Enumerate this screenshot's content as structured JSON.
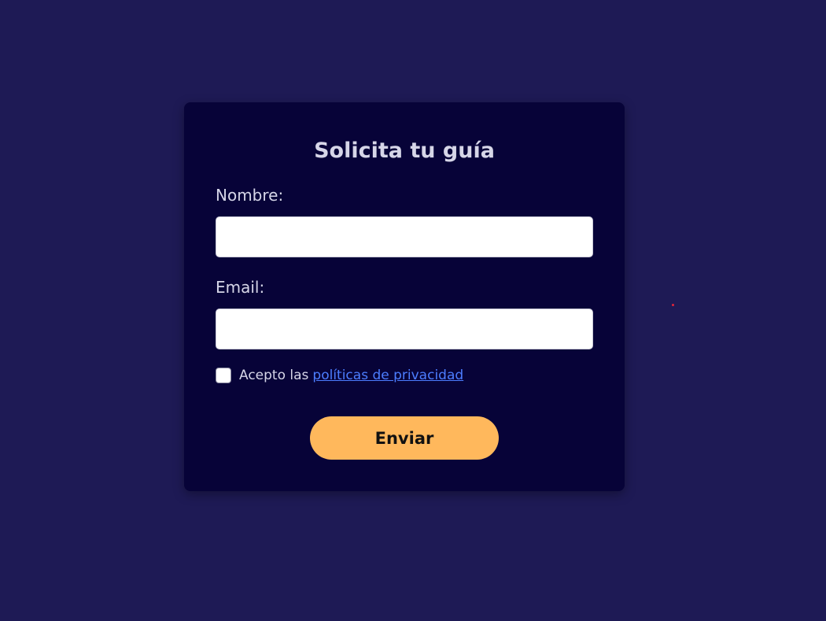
{
  "form": {
    "title": "Solicita tu guía",
    "name_label": "Nombre:",
    "name_value": "",
    "email_label": "Email:",
    "email_value": "",
    "consent_prefix": "Acepto las",
    "consent_link": "políticas de privacidad",
    "consent_checked": false,
    "submit_label": "Enviar"
  },
  "colors": {
    "background": "#1e1a55",
    "card": "#070338",
    "text": "#d6d6e8",
    "link": "#4c7dff",
    "button": "#ffb85c",
    "button_text": "#111111",
    "dot": "#e0243a"
  }
}
